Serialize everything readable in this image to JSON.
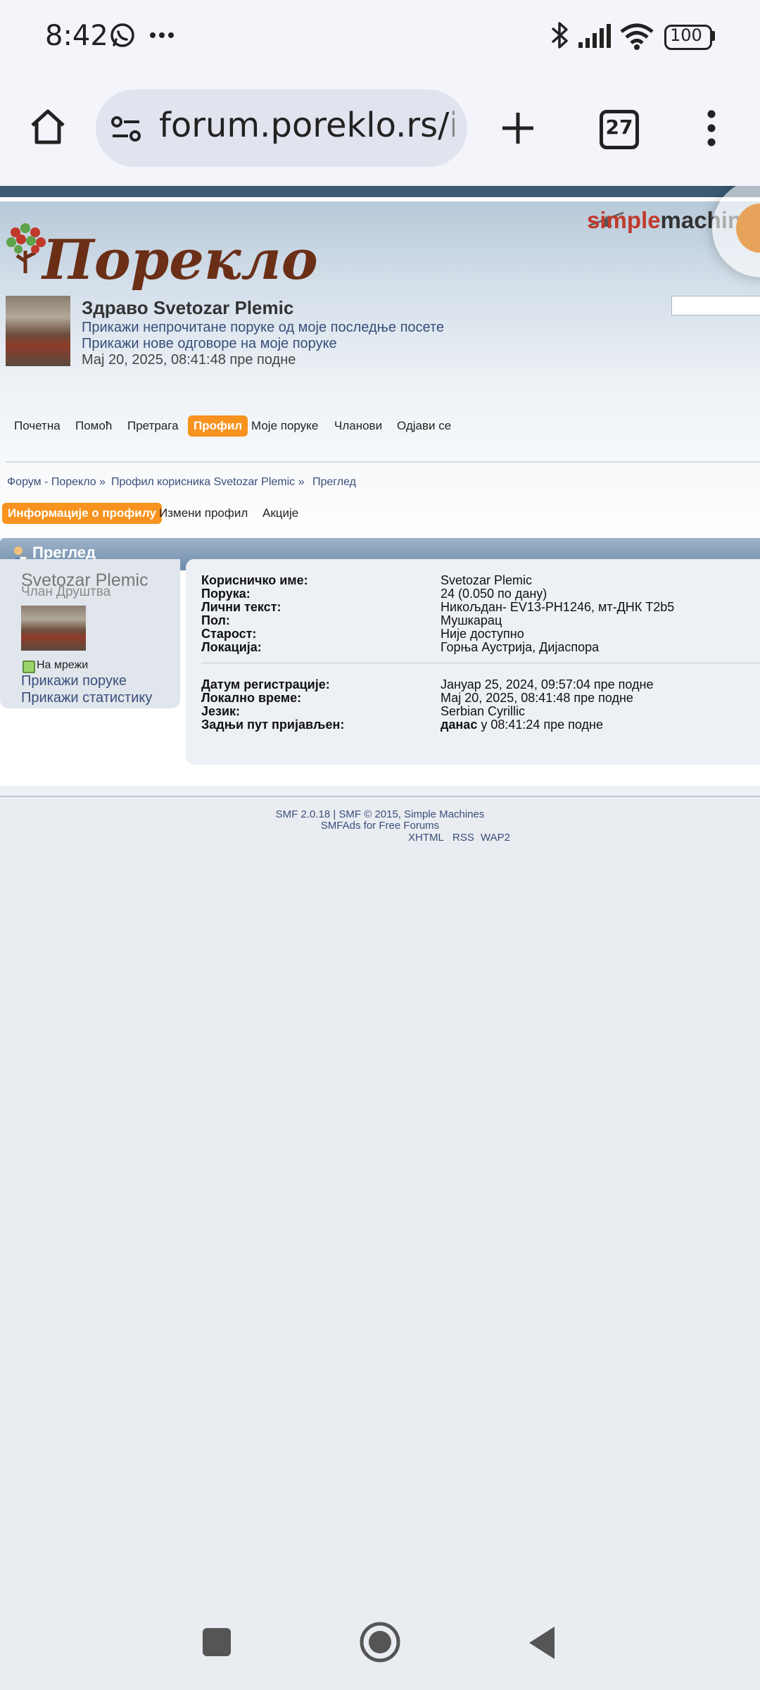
{
  "status_bar": {
    "time": "8:42",
    "battery": "100",
    "icons": [
      "whatsapp-icon",
      "more-dots-icon",
      "bluetooth-icon",
      "signal-icon",
      "wifi-icon",
      "battery-icon"
    ]
  },
  "browser": {
    "url_visible": "forum.poreklo.rs/",
    "url_faded": "inde",
    "tab_count": "27",
    "icons": [
      "home-icon",
      "site-settings-icon",
      "new-tab-icon",
      "tabs-icon",
      "overflow-menu-icon"
    ]
  },
  "header": {
    "logo_text": "Порекло",
    "smf_logo_a": "simple",
    "smf_logo_b": "machin",
    "greeting": "Здраво Svetozar Plemic",
    "link_unread": "Прикажи непрочитане поруке од моје последње посете",
    "link_replies": "Прикажи нове одговоре на моје поруке",
    "datetime": "Мај 20, 2025, 08:41:48 пре подне"
  },
  "menu": [
    {
      "label": "Почетна",
      "active": false
    },
    {
      "label": "Помоћ",
      "active": false
    },
    {
      "label": "Претрага",
      "active": false
    },
    {
      "label": "Профил",
      "active": true
    },
    {
      "label": "Моје поруке",
      "active": false
    },
    {
      "label": "Чланови",
      "active": false
    },
    {
      "label": "Одјави се",
      "active": false
    }
  ],
  "breadcrumb": [
    "Форум - Порекло »",
    "Профил корисника Svetozar Plemic »",
    "Преглед"
  ],
  "subtabs": [
    "Информације о профилу",
    "Измени профил",
    "Акције"
  ],
  "section_title": "Преглед",
  "profile": {
    "name": "Svetozar Plemic",
    "role": "Члан Друштва",
    "online": "На мрежи",
    "link_posts": "Прикажи поруке",
    "link_stats": "Прикажи статистику",
    "fields": [
      {
        "label": "Корисничко име:",
        "value": "Svetozar Plemic"
      },
      {
        "label": "Порука:",
        "value": "24 (0.050 по дану)"
      },
      {
        "label": "Лични текст:",
        "value": "Никољдан- EV13-PH1246, мт-ДНК T2b5"
      },
      {
        "label": "Пол:",
        "value": "Мушкарац"
      },
      {
        "label": "Старост:",
        "value": "Није доступно"
      },
      {
        "label": "Локација:",
        "value": "Горња Аустрија, Дијаспора"
      }
    ],
    "fields2": [
      {
        "label": "Датум регистрације:",
        "value": "Јануар 25, 2024, 09:57:04 пре подне"
      },
      {
        "label": "Локално време:",
        "value": "Мај 20, 2025, 08:41:48 пре подне"
      },
      {
        "label": "Језик:",
        "value": "Serbian Cyrillic"
      },
      {
        "label": "Задњи пут пријављен:",
        "value_bold": "данас",
        "value_rest": " у 08:41:24 пре подне"
      }
    ]
  },
  "footer": {
    "line1": "SMF 2.0.18 | SMF © 2015, Simple Machines",
    "line2": "SMFAds for Free Forums",
    "links": [
      "XHTML",
      "RSS",
      "WAP2"
    ]
  },
  "colors": {
    "accent_orange": "#f7931e",
    "link_blue": "#3a4e7a",
    "header_bar": "#3b5a73"
  },
  "nav_icons": [
    "recents-square-icon",
    "home-circle-icon",
    "back-triangle-icon"
  ]
}
